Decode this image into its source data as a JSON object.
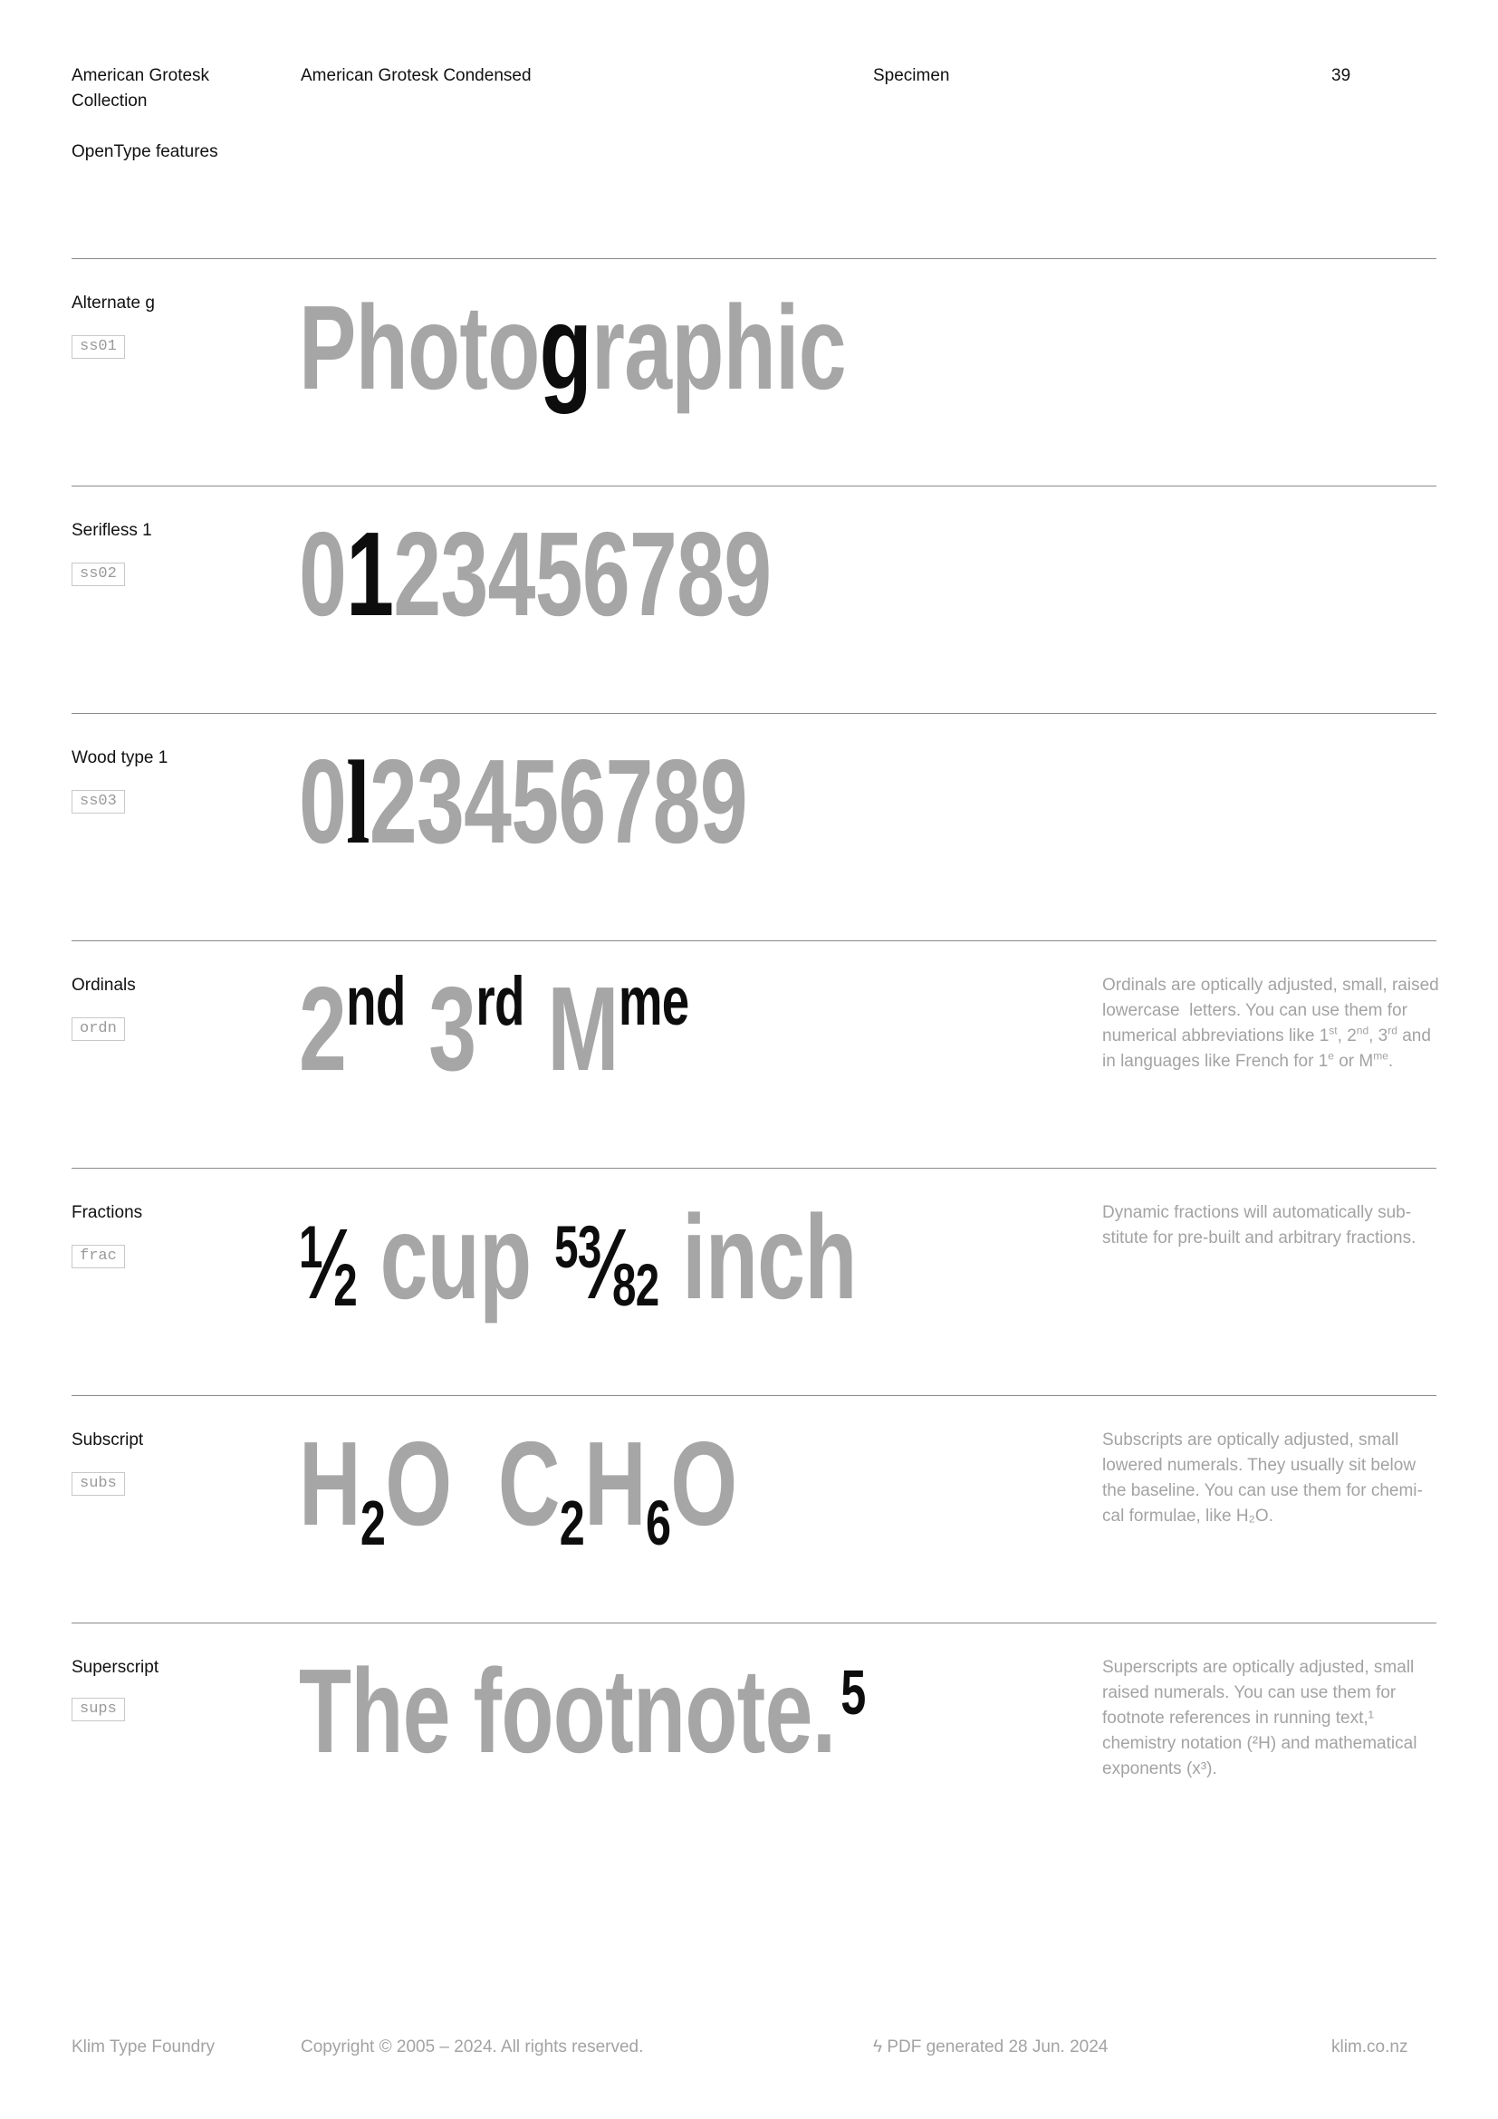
{
  "header": {
    "collection": "American Grotesk Collection",
    "section": "OpenType features",
    "family": "American Grotesk Condensed",
    "doc_type": "Specimen",
    "page_number": "39"
  },
  "features": [
    {
      "label": "Alternate g",
      "tag": "ss01",
      "sample_a": "Photo",
      "sample_b": "g",
      "sample_c": "raphic"
    },
    {
      "label": "Serifless 1",
      "tag": "ss02",
      "sample_a": "0",
      "sample_b": "1",
      "sample_c": "23456789"
    },
    {
      "label": "Wood type 1",
      "tag": "ss03",
      "sample_a": "0",
      "sample_b": "l",
      "sample_c": "23456789"
    },
    {
      "label": "Ordinals",
      "tag": "ordn",
      "s1": "2",
      "o1": "nd",
      "s2": "3",
      "o2": "rd",
      "s3": "M",
      "o3": "me",
      "description": "Ordinals are optically adjusted, small, raised lowercase  letters. You can use them for numerical abbreviations like 1st, 2nd, 3rd and in languages like French for 1e or Mme."
    },
    {
      "label": "Fractions",
      "tag": "frac",
      "n1": "1",
      "d1": "2",
      "w1": " cup ",
      "n2": "53",
      "d2": "82",
      "w2": " inch",
      "description": "Dynamic fractions will automatically sub-stitute for pre-built and arbitrary fractions."
    },
    {
      "label": "Subscript",
      "tag": "subs",
      "a": "H",
      "s1": "2",
      "b": "O  C",
      "s2": "2",
      "c": "H",
      "s3": "6",
      "d": "O",
      "description": "Subscripts are optically adjusted, small lowered numerals. They usually sit below the baseline. You can use them for chemi-cal formulae, like H₂O."
    },
    {
      "label": "Superscript",
      "tag": "sups",
      "text": "The footnote.",
      "sup": "5",
      "description": "Superscripts are optically adjusted, small raised numerals. You can use them for footnote references in running text,¹ chemistry notation (²H) and mathematical exponents (x³)."
    }
  ],
  "footer": {
    "foundry": "Klim Type Foundry",
    "copyright": "Copyright © 2005 – 2024. All rights reserved.",
    "generated": "ϟ PDF generated 28 Jun. 2024",
    "website": "klim.co.nz"
  }
}
